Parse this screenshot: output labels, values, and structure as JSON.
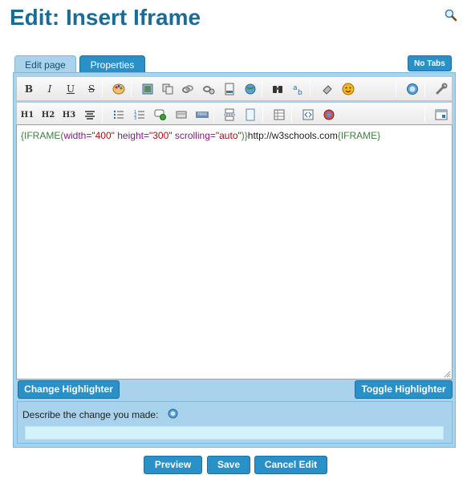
{
  "page": {
    "title": "Edit: Insert Iframe"
  },
  "tabs": {
    "edit": "Edit page",
    "properties": "Properties",
    "no_tabs": "No Tabs"
  },
  "toolbar1": [
    {
      "name": "bold-button",
      "glyph": "B",
      "icon": "bold-icon"
    },
    {
      "name": "italic-button",
      "glyph": "I",
      "icon": "italic-icon"
    },
    {
      "name": "underline-button",
      "glyph": "U",
      "icon": "underline-icon"
    },
    {
      "name": "strikethrough-button",
      "glyph": "S",
      "icon": "strikethrough-icon"
    },
    {
      "name": "color-button",
      "icon": "palette-icon"
    },
    {
      "name": "image-button",
      "icon": "image-icon"
    },
    {
      "name": "copy-button",
      "icon": "copy-icon"
    },
    {
      "name": "link-button",
      "icon": "link-icon"
    },
    {
      "name": "external-link-button",
      "icon": "external-link-icon"
    },
    {
      "name": "file-button",
      "icon": "file-icon"
    },
    {
      "name": "web-button",
      "icon": "globe-icon"
    },
    {
      "name": "binoculars-button",
      "icon": "binoculars-icon"
    },
    {
      "name": "translate-button",
      "icon": "translate-icon"
    },
    {
      "name": "eraser-button",
      "icon": "eraser-icon"
    },
    {
      "name": "smiley-button",
      "icon": "smiley-icon"
    },
    {
      "name": "help-button",
      "icon": "help-icon"
    },
    {
      "name": "settings-button",
      "icon": "wrench-icon"
    }
  ],
  "toolbar2": [
    {
      "name": "h1-button",
      "glyph": "H1",
      "icon": "h1-icon"
    },
    {
      "name": "h2-button",
      "glyph": "H2",
      "icon": "h2-icon"
    },
    {
      "name": "h3-button",
      "glyph": "H3",
      "icon": "h3-icon"
    },
    {
      "name": "center-button",
      "icon": "align-center-icon"
    },
    {
      "name": "bullet-list-button",
      "icon": "bullet-list-icon"
    },
    {
      "name": "number-list-button",
      "icon": "numbered-list-icon"
    },
    {
      "name": "comment-button",
      "icon": "comment-icon"
    },
    {
      "name": "box-button",
      "icon": "box-icon"
    },
    {
      "name": "html-button",
      "glyph": "html",
      "icon": "html-icon"
    },
    {
      "name": "page-break-button",
      "icon": "page-break-icon"
    },
    {
      "name": "page-button",
      "icon": "page-icon"
    },
    {
      "name": "table-button",
      "icon": "table-icon"
    },
    {
      "name": "code-button",
      "icon": "code-icon"
    },
    {
      "name": "plugin-button",
      "icon": "plugin-icon"
    },
    {
      "name": "window-button",
      "icon": "window-icon"
    }
  ],
  "content": {
    "open_brace": "{IFRAME(",
    "attr_width": "width=",
    "val_width": "\"400\"",
    "attr_height": " height=",
    "val_height": "\"300\"",
    "attr_scroll": " scrolling=",
    "val_scroll": "\"auto\"",
    "close_paren": ")}",
    "url": "http://w3schools.com",
    "close_tag": "{IFRAME}"
  },
  "highlighter": {
    "change": "Change Highlighter",
    "toggle": "Toggle Highlighter"
  },
  "describe": {
    "label": "Describe the change you made:",
    "value": ""
  },
  "actions": {
    "preview": "Preview",
    "save": "Save",
    "cancel": "Cancel Edit"
  }
}
